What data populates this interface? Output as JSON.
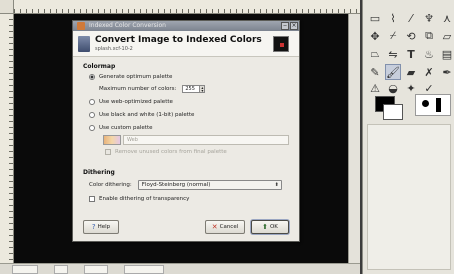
{
  "image_window": {
    "status": {
      "coords": "",
      "unit": "",
      "zoom": "",
      "info": ""
    }
  },
  "dialog": {
    "window_title": "Indexed Color Conversion",
    "heading": "Convert Image to Indexed Colors",
    "subheading": "splash.xcf-10-2",
    "colormap": {
      "section_title": "Colormap",
      "generate_optimum": "Generate optimum palette",
      "max_colors_label": "Maximum number of colors:",
      "max_colors_value": "255",
      "use_web": "Use web-optimized palette",
      "use_bw": "Use black and white (1-bit) palette",
      "use_custom": "Use custom palette",
      "custom_palette_name": "Web",
      "remove_unused": "Remove unused colors from final palette",
      "selected": "generate_optimum"
    },
    "dithering": {
      "section_title": "Dithering",
      "color_dithering_label": "Color dithering:",
      "color_dithering_value": "Floyd-Steinberg (normal)",
      "enable_transparency": "Enable dithering of transparency",
      "enable_transparency_checked": false
    },
    "buttons": {
      "help": "Help",
      "cancel": "Cancel",
      "ok": "OK"
    }
  },
  "toolbox": {
    "tools": [
      "rect-select-icon",
      "free-select-icon",
      "fuzzy-select-icon",
      "paths-icon",
      "move-icon",
      "crop-icon",
      "rotate-icon",
      "scale-icon",
      "shear-icon",
      "perspective-icon",
      "text-icon",
      "bucket-fill-icon",
      "pencil-icon",
      "paintbrush-icon",
      "eraser-icon",
      "airbrush-icon",
      "clone-icon",
      "smudge-icon",
      "dodge-icon"
    ],
    "active_tool": "paintbrush-icon",
    "fg_color": "#000000",
    "bg_color": "#ffffff"
  }
}
